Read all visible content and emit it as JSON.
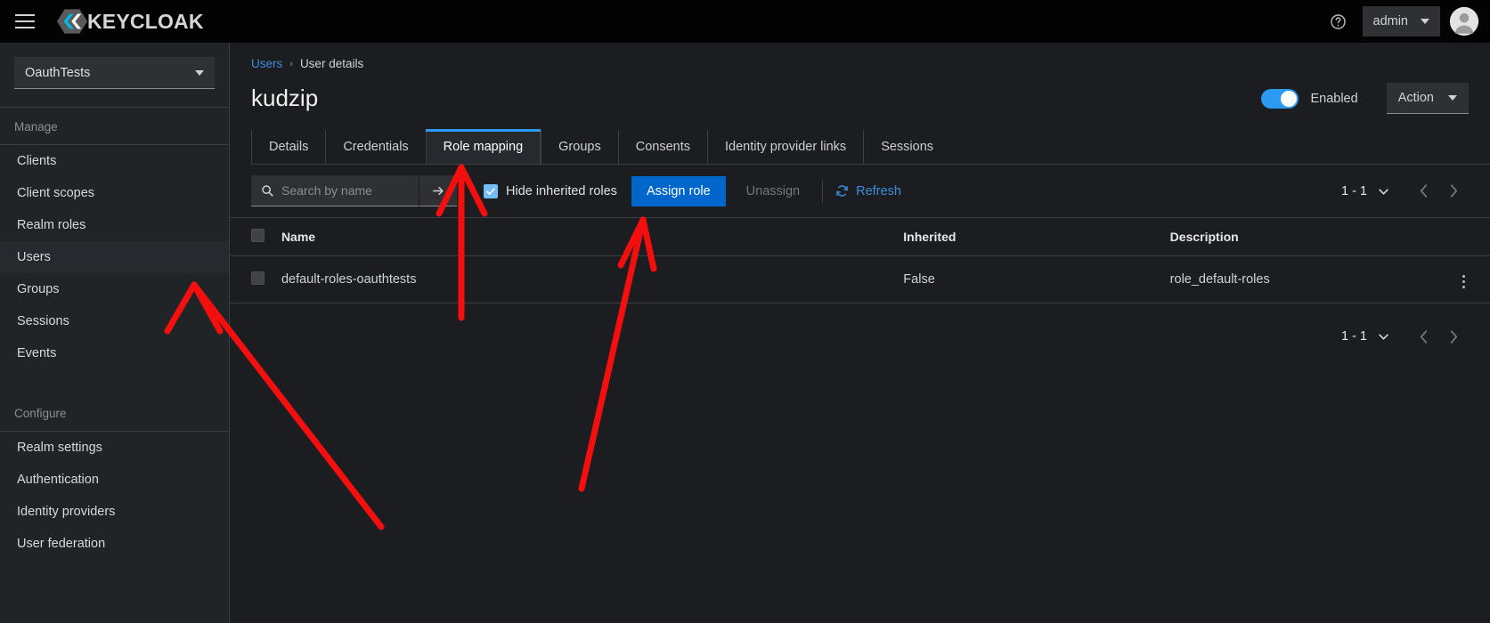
{
  "masthead": {
    "menu_icon": "hamburger-menu-icon",
    "brand": "KEYCLOAK",
    "help_icon": "help-circle-icon",
    "admin_label": "admin",
    "avatar_icon": "user-avatar-icon"
  },
  "sidebar": {
    "realm": "OauthTests",
    "sections": [
      {
        "title": "Manage",
        "items": [
          {
            "label": "Clients",
            "active": false
          },
          {
            "label": "Client scopes",
            "active": false
          },
          {
            "label": "Realm roles",
            "active": false
          },
          {
            "label": "Users",
            "active": true
          },
          {
            "label": "Groups",
            "active": false
          },
          {
            "label": "Sessions",
            "active": false
          },
          {
            "label": "Events",
            "active": false
          }
        ]
      },
      {
        "title": "Configure",
        "items": [
          {
            "label": "Realm settings",
            "active": false
          },
          {
            "label": "Authentication",
            "active": false
          },
          {
            "label": "Identity providers",
            "active": false
          },
          {
            "label": "User federation",
            "active": false
          }
        ]
      }
    ]
  },
  "breadcrumb": {
    "parent": "Users",
    "separator": "›",
    "current": "User details"
  },
  "header": {
    "title": "kudzip",
    "enabled_label": "Enabled",
    "enabled_state": true,
    "action_label": "Action"
  },
  "tabs": [
    {
      "label": "Details",
      "active": false
    },
    {
      "label": "Credentials",
      "active": false
    },
    {
      "label": "Role mapping",
      "active": true
    },
    {
      "label": "Groups",
      "active": false
    },
    {
      "label": "Consents",
      "active": false
    },
    {
      "label": "Identity provider links",
      "active": false
    },
    {
      "label": "Sessions",
      "active": false
    }
  ],
  "toolbar": {
    "search_placeholder": "Search by name",
    "search_value": "",
    "search_icon": "search-icon",
    "search_submit_icon": "arrow-right-icon",
    "hide_inherited_label": "Hide inherited roles",
    "hide_inherited_checked": true,
    "assign_role_label": "Assign role",
    "unassign_label": "Unassign",
    "refresh_label": "Refresh",
    "refresh_icon": "refresh-icon"
  },
  "pagination": {
    "range_top": "1 - 1",
    "range_bottom": "1 - 1",
    "prev_icon": "chevron-left-icon",
    "next_icon": "chevron-right-icon",
    "caret_icon": "caret-down-icon"
  },
  "table": {
    "columns": [
      "Name",
      "Inherited",
      "Description"
    ],
    "rows": [
      {
        "name": "default-roles-oauthtests",
        "inherited": "False",
        "description": "role_default-roles",
        "selected": false
      }
    ],
    "kebab_icon": "kebab-menu-icon"
  },
  "colors": {
    "accent_blue": "#2b9af3",
    "primary_button": "#0066cc",
    "link_blue": "#3b8ddb",
    "annotation_red": "#f40f0f",
    "masthead_bg": "#030303",
    "sidebar_bg": "#212427",
    "main_bg": "#1b1d21"
  },
  "annotations": {
    "arrow_color": "#f40f0f",
    "arrows": [
      {
        "name": "arrow-to-users-sidebar-item",
        "target": "Users"
      },
      {
        "name": "arrow-to-role-mapping-tab",
        "target": "Role mapping"
      },
      {
        "name": "arrow-to-assign-role-button",
        "target": "Assign role"
      }
    ]
  }
}
